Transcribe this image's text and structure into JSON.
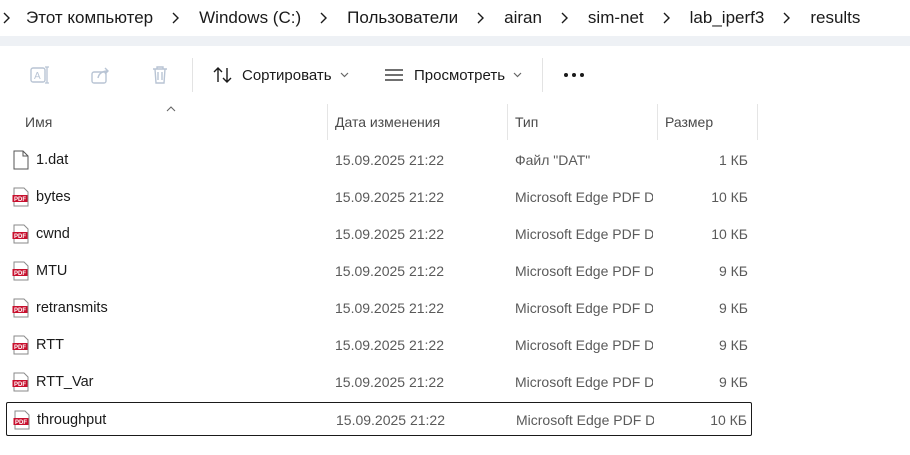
{
  "breadcrumb": {
    "items": [
      "Этот компьютер",
      "Windows (C:)",
      "Пользователи",
      "airan",
      "sim-net",
      "lab_iperf3",
      "results"
    ]
  },
  "toolbar": {
    "rename_icon": "rename-icon",
    "share_icon": "share-icon",
    "delete_icon": "delete-icon",
    "sort_label": "Сортировать",
    "view_label": "Просмотреть",
    "more_label": "•••"
  },
  "columns": {
    "name": "Имя",
    "date": "Дата изменения",
    "type": "Тип",
    "size": "Размер"
  },
  "files": [
    {
      "name": "1.dat",
      "date": "15.09.2025 21:22",
      "type": "Файл \"DAT\"",
      "size": "1 КБ",
      "icon": "generic-file-icon"
    },
    {
      "name": "bytes",
      "date": "15.09.2025 21:22",
      "type": "Microsoft Edge PDF Document",
      "size": "10 КБ",
      "icon": "pdf-icon"
    },
    {
      "name": "cwnd",
      "date": "15.09.2025 21:22",
      "type": "Microsoft Edge PDF Document",
      "size": "10 КБ",
      "icon": "pdf-icon"
    },
    {
      "name": "MTU",
      "date": "15.09.2025 21:22",
      "type": "Microsoft Edge PDF Document",
      "size": "9 КБ",
      "icon": "pdf-icon"
    },
    {
      "name": "retransmits",
      "date": "15.09.2025 21:22",
      "type": "Microsoft Edge PDF Document",
      "size": "9 КБ",
      "icon": "pdf-icon"
    },
    {
      "name": "RTT",
      "date": "15.09.2025 21:22",
      "type": "Microsoft Edge PDF Document",
      "size": "9 КБ",
      "icon": "pdf-icon"
    },
    {
      "name": "RTT_Var",
      "date": "15.09.2025 21:22",
      "type": "Microsoft Edge PDF Document",
      "size": "9 КБ",
      "icon": "pdf-icon"
    },
    {
      "name": "throughput",
      "date": "15.09.2025 21:22",
      "type": "Microsoft Edge PDF Document",
      "size": "10 КБ",
      "icon": "pdf-icon"
    }
  ],
  "colors": {
    "pdf_red": "#c8102e",
    "strip": "#eef1f5",
    "focus_border": "#1a1a1a"
  }
}
